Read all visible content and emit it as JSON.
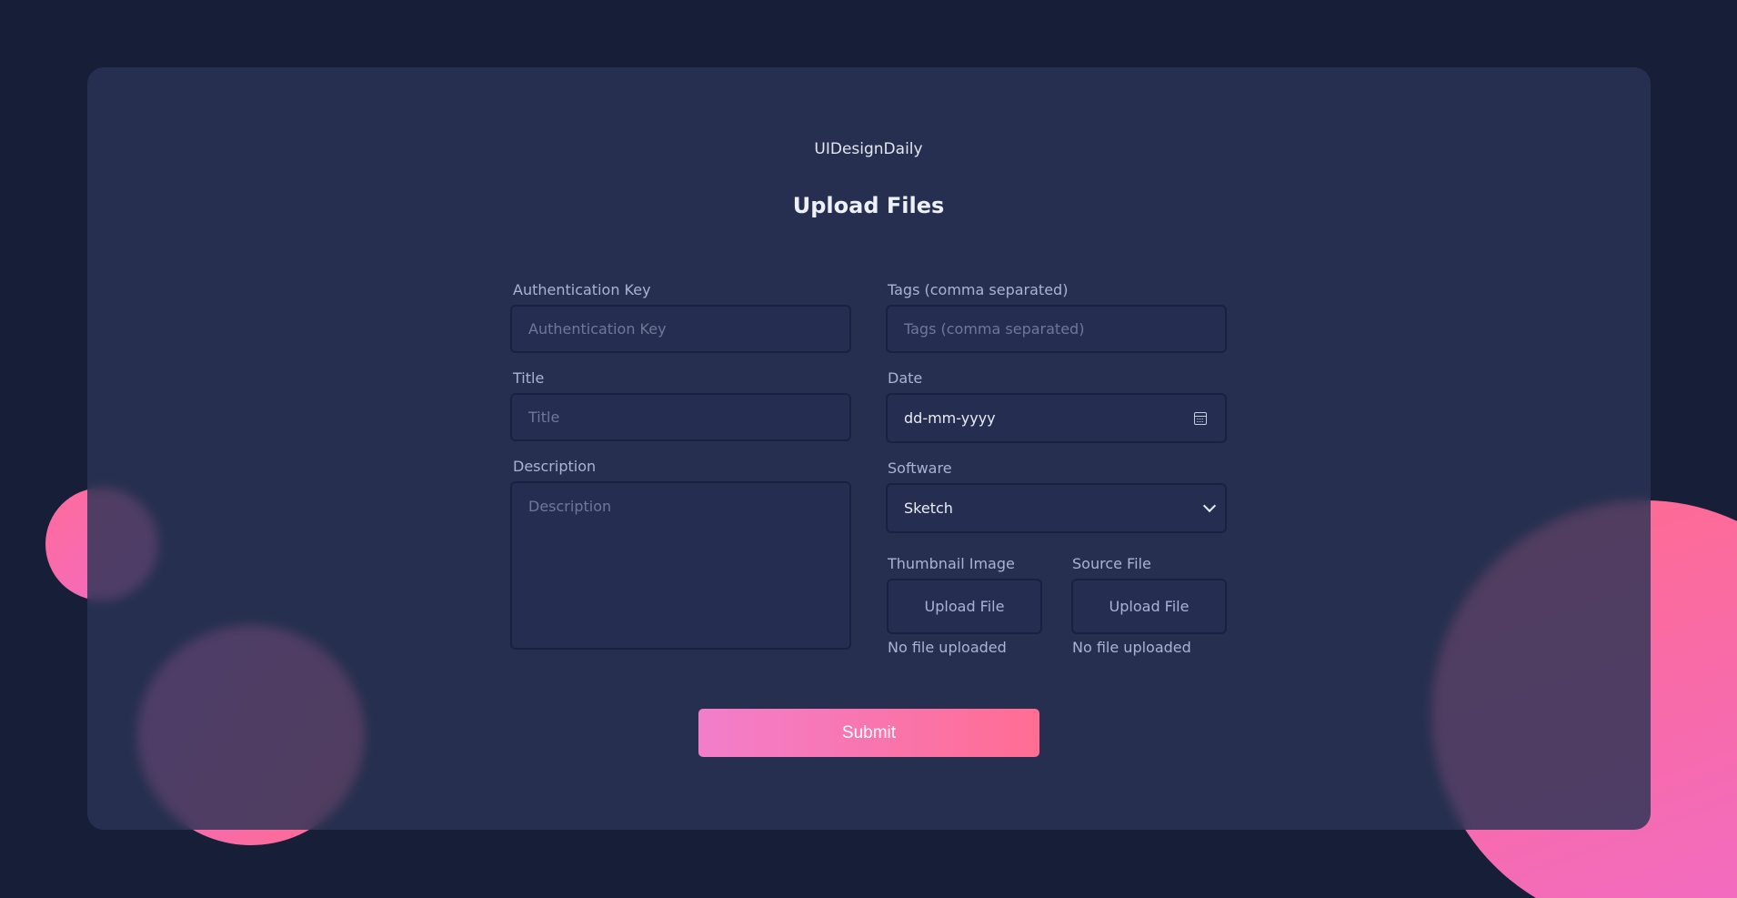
{
  "brand": "UIDesignDaily",
  "title": "Upload Files",
  "form": {
    "auth_key": {
      "label": "Authentication Key",
      "placeholder": "Authentication Key"
    },
    "tags": {
      "label": "Tags (comma separated)",
      "placeholder": "Tags (comma separated)"
    },
    "title_field": {
      "label": "Title",
      "placeholder": "Title"
    },
    "date": {
      "label": "Date",
      "value": "dd-mm-yyyy"
    },
    "description": {
      "label": "Description",
      "placeholder": "Description"
    },
    "software": {
      "label": "Software",
      "selected": "Sketch"
    },
    "thumbnail": {
      "label": "Thumbnail Image",
      "button": "Upload File",
      "status": "No file uploaded"
    },
    "source": {
      "label": "Source File",
      "button": "Upload File",
      "status": "No file uploaded"
    }
  },
  "submit_label": "Submit",
  "colors": {
    "background": "#171e38",
    "card": "#293354",
    "accent_start": "#f27ecb",
    "accent_end": "#ff6d93"
  }
}
